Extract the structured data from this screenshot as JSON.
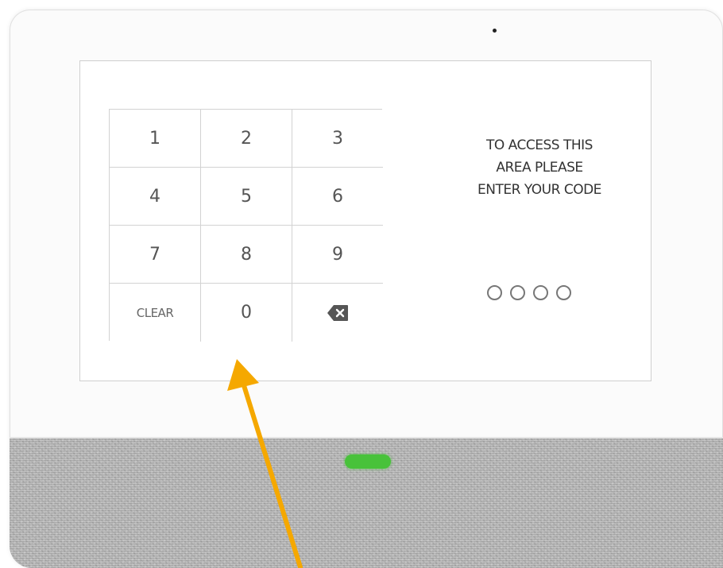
{
  "keypad": {
    "keys": [
      "1",
      "2",
      "3",
      "4",
      "5",
      "6",
      "7",
      "8",
      "9",
      "CLEAR",
      "0"
    ],
    "backspace_icon": "backspace-icon"
  },
  "prompt": {
    "lines": [
      "TO ACCESS THIS",
      "AREA PLEASE",
      "ENTER YOUR CODE"
    ]
  },
  "code_entry": {
    "digits_total": 4,
    "digits_filled": 0
  },
  "status_led": {
    "color": "#48c23a"
  },
  "annotation": {
    "arrow_color": "#f5a800",
    "arrow_target": "0"
  }
}
